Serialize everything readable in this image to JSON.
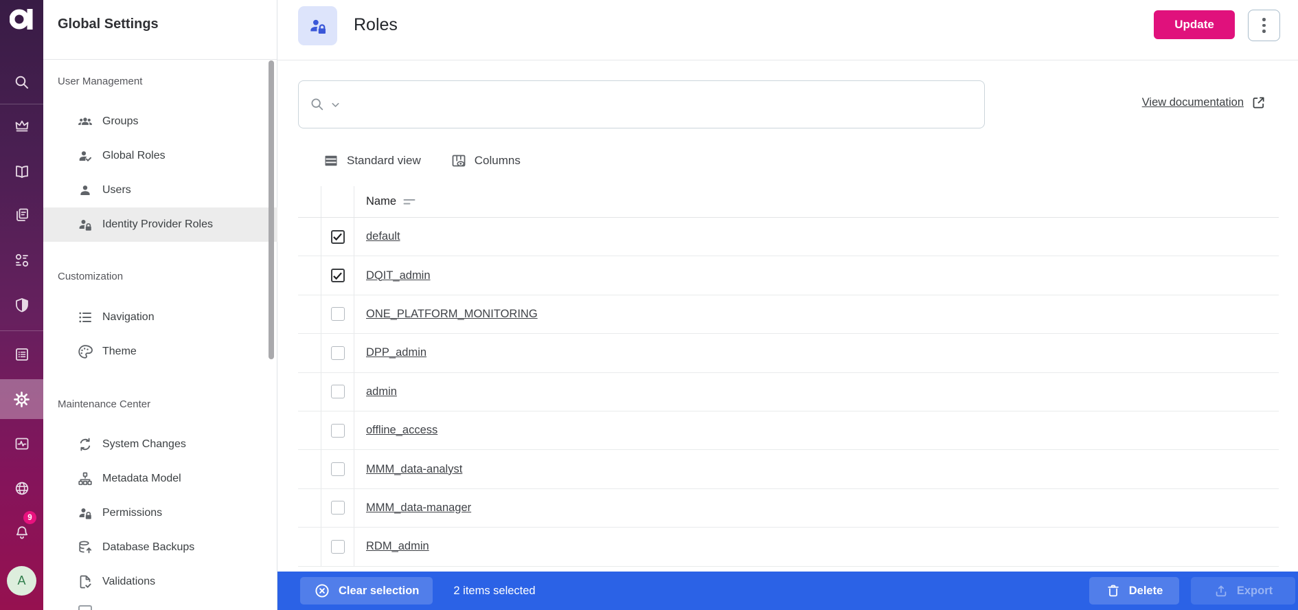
{
  "rail": {
    "items": [
      "search-icon",
      "crown-icon",
      "book-icon",
      "copy-icon",
      "catalog-icon",
      "shield-icon",
      "list-icon",
      "gear-icon",
      "monitor-pulse-icon",
      "globe-icon",
      "bell-icon"
    ],
    "active_item": "gear-icon",
    "notification_count": "9",
    "avatar_initial": "A"
  },
  "sidebar": {
    "title": "Global Settings",
    "sections": [
      {
        "label": "User Management",
        "items": [
          {
            "label": "Groups",
            "icon": "groups-icon"
          },
          {
            "label": "Global Roles",
            "icon": "person-check-icon"
          },
          {
            "label": "Users",
            "icon": "person-icon"
          },
          {
            "label": "Identity Provider Roles",
            "icon": "person-lock-icon",
            "active": true
          }
        ]
      },
      {
        "label": "Customization",
        "items": [
          {
            "label": "Navigation",
            "icon": "bullet-list-icon"
          },
          {
            "label": "Theme",
            "icon": "palette-icon"
          }
        ]
      },
      {
        "label": "Maintenance Center",
        "items": [
          {
            "label": "System Changes",
            "icon": "sync-icon"
          },
          {
            "label": "Metadata Model",
            "icon": "hierarchy-icon"
          },
          {
            "label": "Permissions",
            "icon": "person-lock-icon"
          },
          {
            "label": "Database Backups",
            "icon": "database-upload-icon"
          },
          {
            "label": "Validations",
            "icon": "document-check-icon"
          }
        ]
      }
    ]
  },
  "header": {
    "title": "Roles",
    "icon": "person-lock-icon",
    "update_label": "Update"
  },
  "search": {
    "value": "",
    "placeholder": ""
  },
  "docs_link": {
    "label": "View documentation",
    "icon": "external-link-icon"
  },
  "toolbar": {
    "standard_view_label": "Standard view",
    "columns_label": "Columns"
  },
  "table": {
    "columns": [
      {
        "label": "Name",
        "sortable": true
      }
    ],
    "rows": [
      {
        "name": "default",
        "checked": true
      },
      {
        "name": "DQIT_admin",
        "checked": true
      },
      {
        "name": "ONE_PLATFORM_MONITORING",
        "checked": false
      },
      {
        "name": "DPP_admin",
        "checked": false
      },
      {
        "name": "admin",
        "checked": false
      },
      {
        "name": "offline_access",
        "checked": false
      },
      {
        "name": "MMM_data-analyst",
        "checked": false
      },
      {
        "name": "MMM_data-manager",
        "checked": false
      },
      {
        "name": "RDM_admin",
        "checked": false
      }
    ]
  },
  "selection_bar": {
    "clear_label": "Clear selection",
    "status": "2 items selected",
    "delete_label": "Delete",
    "export_label": "Export",
    "export_enabled": false
  },
  "colors": {
    "accent_pink": "#e0117c",
    "selection_blue": "#2b62e6",
    "rail_gradient_top": "#381c45",
    "rail_gradient_bottom": "#961150",
    "page_icon_tile_bg": "#dde4fb",
    "page_icon_blue": "#3a57d8",
    "avatar_bg": "#ddeedd",
    "avatar_text": "#2f7d4b",
    "selected_item_bg": "#ececec"
  }
}
